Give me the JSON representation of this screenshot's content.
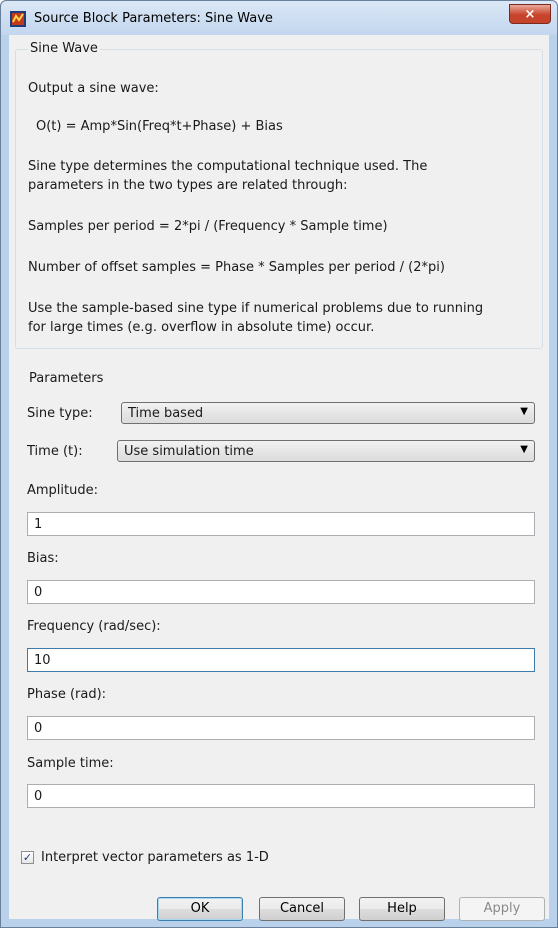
{
  "window": {
    "title": "Source Block Parameters: Sine Wave",
    "close_glyph": "×",
    "icon": "simulink-block-icon"
  },
  "description": {
    "group_title": "Sine Wave",
    "lines": [
      "Output a sine wave:",
      "O(t) = Amp*Sin(Freq*t+Phase) + Bias",
      "Sine type determines the computational technique used. The",
      "parameters in the two types are related through:",
      "Samples per period = 2*pi / (Frequency * Sample time)",
      "Number of offset samples = Phase * Samples per period / (2*pi)",
      "Use the sample-based sine type if numerical problems due to running",
      "for large times (e.g. overflow in absolute time) occur."
    ]
  },
  "parameters": {
    "group_title": "Parameters",
    "sine_type": {
      "label": "Sine type:",
      "value": "Time based"
    },
    "time": {
      "label": "Time (t):",
      "value": "Use simulation time"
    },
    "amplitude": {
      "label": "Amplitude:",
      "value": "1"
    },
    "bias": {
      "label": "Bias:",
      "value": "0"
    },
    "frequency": {
      "label": "Frequency (rad/sec):",
      "value": "10"
    },
    "phase": {
      "label": "Phase (rad):",
      "value": "0"
    },
    "sample_time": {
      "label": "Sample time:",
      "value": "0"
    },
    "interpret_vector": {
      "label": "Interpret vector parameters as 1-D",
      "checked": true,
      "check_glyph": "✓"
    }
  },
  "buttons": {
    "ok": "OK",
    "cancel": "Cancel",
    "help": "Help",
    "apply": "Apply"
  },
  "combo_arrow": "▼",
  "colors": {
    "title_bar": "#c2d6ee",
    "close_button": "#c7432a",
    "dialog_bg": "#f0f0f0",
    "focus_border": "#3d7bad"
  }
}
